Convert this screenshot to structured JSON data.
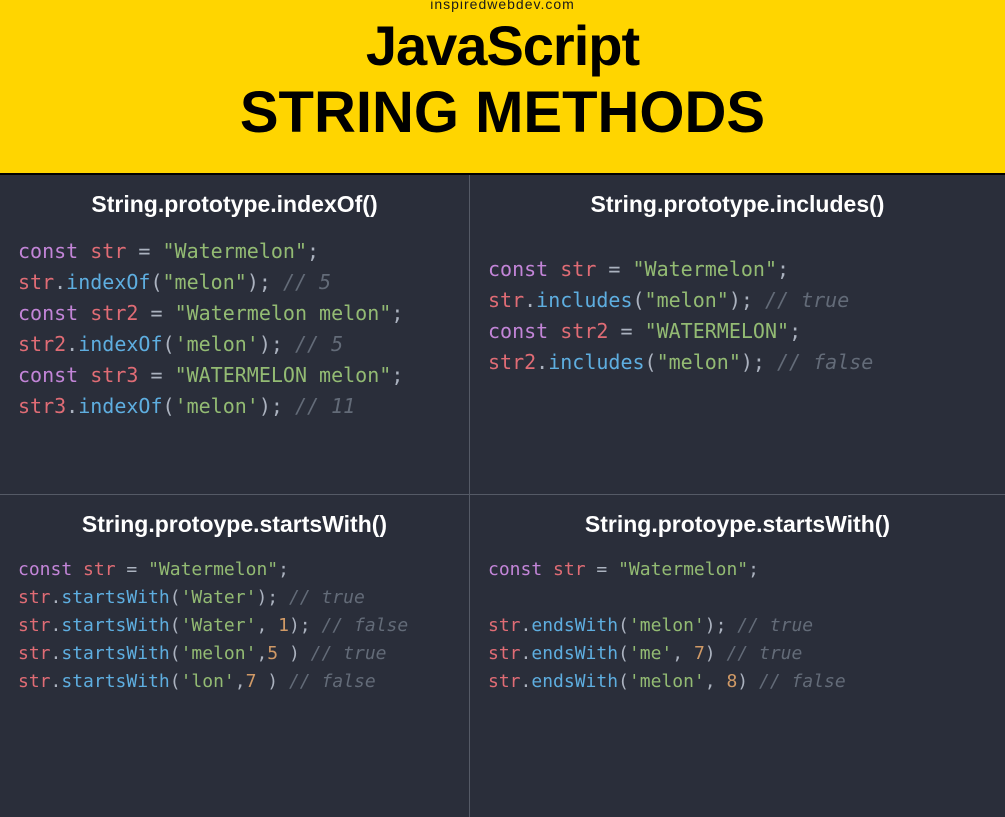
{
  "watermark": "inspiredwebdev.com",
  "header": {
    "line1": "JavaScript",
    "line2": "STRING METHODS"
  },
  "cells": [
    {
      "title": "String.prototype.indexOf()",
      "size": "large",
      "lines": [
        [
          {
            "t": "const ",
            "c": "kw"
          },
          {
            "t": "str ",
            "c": "var"
          },
          {
            "t": "= ",
            "c": "op"
          },
          {
            "t": "\"Watermelon\"",
            "c": "str"
          },
          {
            "t": ";",
            "c": "op"
          }
        ],
        [
          {
            "t": "str",
            "c": "var"
          },
          {
            "t": ".",
            "c": "op"
          },
          {
            "t": "indexOf",
            "c": "fn"
          },
          {
            "t": "(",
            "c": "op"
          },
          {
            "t": "\"melon\"",
            "c": "str"
          },
          {
            "t": "); ",
            "c": "op"
          },
          {
            "t": "// 5",
            "c": "cmt"
          }
        ],
        [
          {
            "t": "const ",
            "c": "kw"
          },
          {
            "t": "str2 ",
            "c": "var"
          },
          {
            "t": "= ",
            "c": "op"
          },
          {
            "t": "\"Watermelon melon\"",
            "c": "str"
          },
          {
            "t": ";",
            "c": "op"
          }
        ],
        [
          {
            "t": "str2",
            "c": "var"
          },
          {
            "t": ".",
            "c": "op"
          },
          {
            "t": "indexOf",
            "c": "fn"
          },
          {
            "t": "(",
            "c": "op"
          },
          {
            "t": "'melon'",
            "c": "str"
          },
          {
            "t": "); ",
            "c": "op"
          },
          {
            "t": "// 5",
            "c": "cmt"
          }
        ],
        [
          {
            "t": "const ",
            "c": "kw"
          },
          {
            "t": "str3 ",
            "c": "var"
          },
          {
            "t": "= ",
            "c": "op"
          },
          {
            "t": "\"WATERMELON melon\"",
            "c": "str"
          },
          {
            "t": ";",
            "c": "op"
          }
        ],
        [
          {
            "t": "str3",
            "c": "var"
          },
          {
            "t": ".",
            "c": "op"
          },
          {
            "t": "indexOf",
            "c": "fn"
          },
          {
            "t": "(",
            "c": "op"
          },
          {
            "t": "'melon'",
            "c": "str"
          },
          {
            "t": "); ",
            "c": "op"
          },
          {
            "t": "// 11",
            "c": "cmt"
          }
        ]
      ]
    },
    {
      "title": "String.prototype.includes()",
      "size": "large",
      "padClass": "cell-pad-includes",
      "lines": [
        [
          {
            "t": "const ",
            "c": "kw"
          },
          {
            "t": "str ",
            "c": "var"
          },
          {
            "t": "= ",
            "c": "op"
          },
          {
            "t": "\"Watermelon\"",
            "c": "str"
          },
          {
            "t": ";",
            "c": "op"
          }
        ],
        [
          {
            "t": "str",
            "c": "var"
          },
          {
            "t": ".",
            "c": "op"
          },
          {
            "t": "includes",
            "c": "fn"
          },
          {
            "t": "(",
            "c": "op"
          },
          {
            "t": "\"melon\"",
            "c": "str"
          },
          {
            "t": "); ",
            "c": "op"
          },
          {
            "t": "// true",
            "c": "cmt"
          }
        ],
        [
          {
            "t": "const ",
            "c": "kw"
          },
          {
            "t": "str2 ",
            "c": "var"
          },
          {
            "t": "= ",
            "c": "op"
          },
          {
            "t": "\"WATERMELON\"",
            "c": "str"
          },
          {
            "t": ";",
            "c": "op"
          }
        ],
        [
          {
            "t": "str2",
            "c": "var"
          },
          {
            "t": ".",
            "c": "op"
          },
          {
            "t": "includes",
            "c": "fn"
          },
          {
            "t": "(",
            "c": "op"
          },
          {
            "t": "\"melon\"",
            "c": "str"
          },
          {
            "t": "); ",
            "c": "op"
          },
          {
            "t": "// false",
            "c": "cmt"
          }
        ]
      ]
    },
    {
      "title": "String.protoype.startsWith()",
      "size": "small",
      "lines": [
        [
          {
            "t": "const ",
            "c": "kw"
          },
          {
            "t": "str ",
            "c": "var"
          },
          {
            "t": "= ",
            "c": "op"
          },
          {
            "t": "\"Watermelon\"",
            "c": "str"
          },
          {
            "t": ";",
            "c": "op"
          }
        ],
        [
          {
            "t": "str",
            "c": "var"
          },
          {
            "t": ".",
            "c": "op"
          },
          {
            "t": "startsWith",
            "c": "fn"
          },
          {
            "t": "(",
            "c": "op"
          },
          {
            "t": "'Water'",
            "c": "str"
          },
          {
            "t": "); ",
            "c": "op"
          },
          {
            "t": "// true",
            "c": "cmt"
          }
        ],
        [
          {
            "t": "str",
            "c": "var"
          },
          {
            "t": ".",
            "c": "op"
          },
          {
            "t": "startsWith",
            "c": "fn"
          },
          {
            "t": "(",
            "c": "op"
          },
          {
            "t": "'Water'",
            "c": "str"
          },
          {
            "t": ", ",
            "c": "op"
          },
          {
            "t": "1",
            "c": "num"
          },
          {
            "t": "); ",
            "c": "op"
          },
          {
            "t": "// false",
            "c": "cmt"
          }
        ],
        [
          {
            "t": "str",
            "c": "var"
          },
          {
            "t": ".",
            "c": "op"
          },
          {
            "t": "startsWith",
            "c": "fn"
          },
          {
            "t": "(",
            "c": "op"
          },
          {
            "t": "'melon'",
            "c": "str"
          },
          {
            "t": ",",
            "c": "op"
          },
          {
            "t": "5",
            "c": "num"
          },
          {
            "t": " ) ",
            "c": "op"
          },
          {
            "t": "// true",
            "c": "cmt"
          }
        ],
        [
          {
            "t": "str",
            "c": "var"
          },
          {
            "t": ".",
            "c": "op"
          },
          {
            "t": "startsWith",
            "c": "fn"
          },
          {
            "t": "(",
            "c": "op"
          },
          {
            "t": "'lon'",
            "c": "str"
          },
          {
            "t": ",",
            "c": "op"
          },
          {
            "t": "7",
            "c": "num"
          },
          {
            "t": " ) ",
            "c": "op"
          },
          {
            "t": "// false",
            "c": "cmt"
          }
        ]
      ]
    },
    {
      "title": "String.protoype.startsWith()",
      "size": "small",
      "lines": [
        [
          {
            "t": "const ",
            "c": "kw"
          },
          {
            "t": "str ",
            "c": "var"
          },
          {
            "t": "= ",
            "c": "op"
          },
          {
            "t": "\"Watermelon\"",
            "c": "str"
          },
          {
            "t": ";",
            "c": "op"
          }
        ],
        [
          {
            "t": " ",
            "c": "op"
          }
        ],
        [
          {
            "t": "str",
            "c": "var"
          },
          {
            "t": ".",
            "c": "op"
          },
          {
            "t": "endsWith",
            "c": "fn"
          },
          {
            "t": "(",
            "c": "op"
          },
          {
            "t": "'melon'",
            "c": "str"
          },
          {
            "t": "); ",
            "c": "op"
          },
          {
            "t": "// true",
            "c": "cmt"
          }
        ],
        [
          {
            "t": "str",
            "c": "var"
          },
          {
            "t": ".",
            "c": "op"
          },
          {
            "t": "endsWith",
            "c": "fn"
          },
          {
            "t": "(",
            "c": "op"
          },
          {
            "t": "'me'",
            "c": "str"
          },
          {
            "t": ", ",
            "c": "op"
          },
          {
            "t": "7",
            "c": "num"
          },
          {
            "t": ") ",
            "c": "op"
          },
          {
            "t": "// true",
            "c": "cmt"
          }
        ],
        [
          {
            "t": "str",
            "c": "var"
          },
          {
            "t": ".",
            "c": "op"
          },
          {
            "t": "endsWith",
            "c": "fn"
          },
          {
            "t": "(",
            "c": "op"
          },
          {
            "t": "'melon'",
            "c": "str"
          },
          {
            "t": ", ",
            "c": "op"
          },
          {
            "t": "8",
            "c": "num"
          },
          {
            "t": ") ",
            "c": "op"
          },
          {
            "t": "// false",
            "c": "cmt"
          }
        ]
      ]
    }
  ]
}
